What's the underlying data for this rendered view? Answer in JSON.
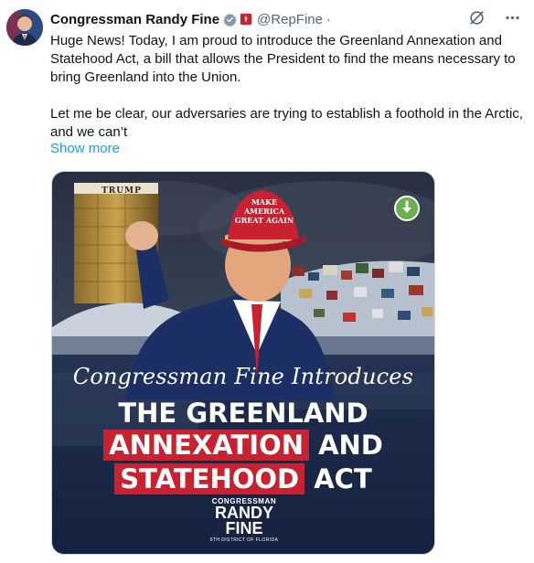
{
  "author": {
    "name": "Congressman Randy Fine",
    "handle": "@RepFine",
    "separator": "·"
  },
  "icons": {
    "verified": "verified-badge-icon",
    "affiliation": "us-flag-badge-icon",
    "grok": "grok-icon",
    "more": "more-icon",
    "download": "download-icon"
  },
  "tweet": {
    "paragraph1": "Huge News!  Today, I am proud to introduce the Greenland Annexation and Statehood Act, a bill that allows the President to find the means necessary to bring Greenland into the Union.",
    "paragraph2": "Let me be clear, our adversaries are trying to establish a foothold in the Arctic, and we can’t",
    "show_more": "Show more"
  },
  "media": {
    "tower_sign": "TRUMP",
    "hat_text": "MAKE AMERICA GREAT AGAIN",
    "script_title": "Congressman Fine Introduces",
    "line1": "THE GREENLAND",
    "line2_highlight": "ANNEXATION",
    "line2_rest": "AND",
    "line3_highlight": "STATEHOOD",
    "line3_rest": "ACT",
    "logo_top": "CONGRESSMAN",
    "logo_name1": "RANDY",
    "logo_name2": "FINE",
    "logo_bottom": "6TH DISTRICT OF FLORIDA"
  },
  "colors": {
    "verified": "#829aab",
    "link": "#1d9bf0",
    "highlight": "#c8212f",
    "download": "#6ab04c"
  }
}
